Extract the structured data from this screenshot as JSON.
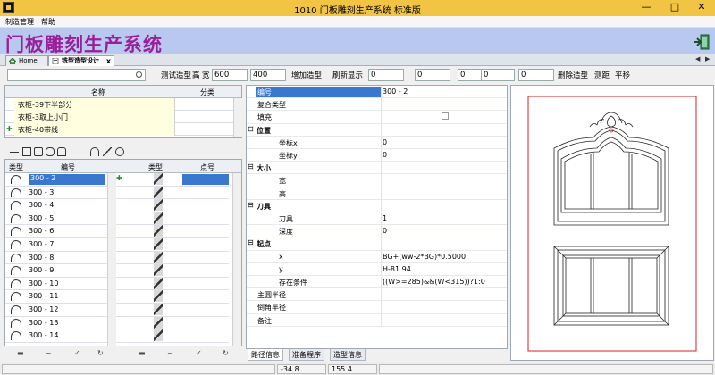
{
  "window": {
    "title": "1010 门板雕刻生产系统 标准版",
    "minimize": "—",
    "maximize": "□",
    "close": "✕"
  },
  "menu": [
    "制造管理",
    "帮助"
  ],
  "banner": {
    "app_title": "门板雕刻生产系统"
  },
  "tabs": {
    "home": "Home",
    "active": "铣型造型设计",
    "close": "✕",
    "scroll_left": "◀",
    "scroll_right": "▶",
    "tab_close": "x"
  },
  "toolbar": {
    "test_shape": "测试造型",
    "height_label": "高",
    "width_label": "宽",
    "width_value": "600",
    "height_value": "400",
    "add_shape": "增加造型",
    "refresh": "刷新显示",
    "fields": [
      "0",
      "0",
      "0",
      "0",
      "0"
    ],
    "delete_shape": "删除造型",
    "measure": "测距",
    "pan": "平移"
  },
  "list": {
    "headers": [
      "名称",
      "分类"
    ],
    "rows": [
      "衣柜-39下半部分",
      "衣柜-3取上小门",
      "衣柜-40带线"
    ]
  },
  "shape_grid": {
    "headers": [
      "类型",
      "编号",
      "类型",
      "点号"
    ],
    "rows": [
      "300 - 2",
      "300 - 3",
      "300 - 4",
      "300 - 5",
      "300 - 6",
      "300 - 7",
      "300 - 8",
      "300 - 9",
      "300 - 10",
      "300 - 11",
      "300 - 12",
      "300 - 13",
      "300 - 14"
    ]
  },
  "properties": [
    {
      "key": "编号",
      "value": "300 - 2",
      "selected": true
    },
    {
      "key": "复合类型",
      "value": ""
    },
    {
      "key": "填充",
      "value": "",
      "checkbox": true
    },
    {
      "key": "位置",
      "value": "",
      "category": true
    },
    {
      "key": "坐标x",
      "value": "0"
    },
    {
      "key": "坐标y",
      "value": "0"
    },
    {
      "key": "大小",
      "value": "",
      "category": true
    },
    {
      "key": "宽",
      "value": ""
    },
    {
      "key": "高",
      "value": ""
    },
    {
      "key": "刀具",
      "value": "",
      "category": true
    },
    {
      "key": "刀具",
      "value": "1"
    },
    {
      "key": "深度",
      "value": "0"
    },
    {
      "key": "起点",
      "value": "",
      "category": true
    },
    {
      "key": "x",
      "value": "BG+(ww-2*BG)*0.5000"
    },
    {
      "key": "y",
      "value": "H-81.94"
    },
    {
      "key": "存在条件",
      "value": "((W>=285)&&(W<315))?1:0"
    },
    {
      "key": "主圆半径",
      "value": ""
    },
    {
      "key": "倒角半径",
      "value": ""
    },
    {
      "key": "备注",
      "value": ""
    }
  ],
  "subtabs": [
    "路径信息",
    "准备程序",
    "造型信息"
  ],
  "status": {
    "coord_x": "-34.8",
    "coord_y": "155.4"
  },
  "colors": {
    "titlebar": "#f2c443",
    "banner": "#b8c8ee",
    "app_title": "#9a1e9a",
    "selection": "#3a78d0",
    "drawing_border": "#d0202a"
  }
}
